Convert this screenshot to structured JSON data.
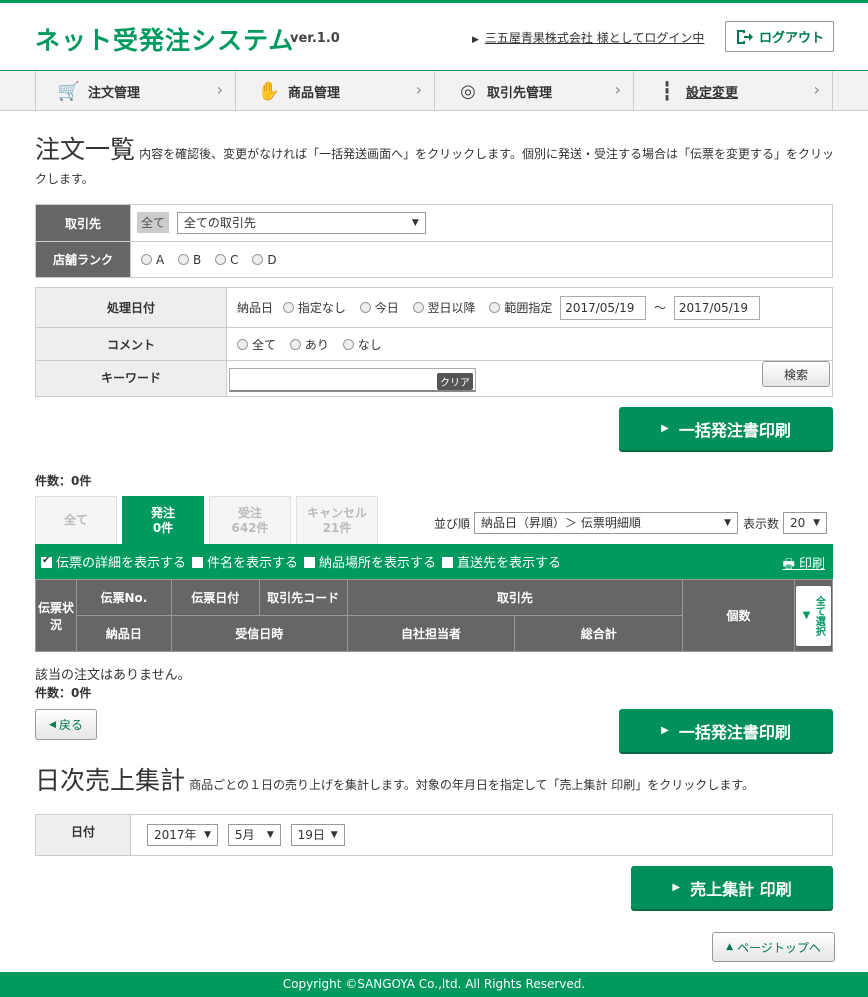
{
  "header": {
    "logo": "ネット受発注システム",
    "version": "ver.1.0",
    "company": "三五屋青果株式会社 様としてログイン中",
    "logout": "ログアウト"
  },
  "nav": [
    {
      "label": "注文管理"
    },
    {
      "label": "商品管理"
    },
    {
      "label": "取引先管理"
    },
    {
      "label": "設定変更"
    }
  ],
  "orders": {
    "title": "注文一覧",
    "desc": "内容を確認後、変更がなければ「一括発送画面へ」をクリックします。個別に発送・受注する場合は「伝票を変更する」をクリックします。",
    "filter": {
      "partner_label": "取引先",
      "partner_all": "全て",
      "partner_select": "全ての取引先",
      "rank_label": "店舗ランク",
      "ranks": [
        "A",
        "B",
        "C",
        "D"
      ],
      "date_label": "処理日付",
      "date_prefix": "納品日",
      "date_options": [
        "指定なし",
        "今日",
        "翌日以降",
        "範囲指定"
      ],
      "date_from": "2017/05/19",
      "date_sep": "～",
      "date_to": "2017/05/19",
      "comment_label": "コメント",
      "comment_options": [
        "全て",
        "あり",
        "なし"
      ],
      "keyword_label": "キーワード",
      "keyword_value": "",
      "clear": "クリア",
      "search": "検索"
    },
    "bulk_print": "一括発注書印刷",
    "count_text": "件数：0件",
    "tabs": [
      {
        "name": "全て",
        "count": ""
      },
      {
        "name": "発注",
        "count": "0件"
      },
      {
        "name": "受注",
        "count": "642件"
      },
      {
        "name": "キャンセル",
        "count": "21件"
      }
    ],
    "sort_label": "並び順",
    "sort_value": "納品日（昇順）＞ 伝票明細順",
    "per_page_label": "表示数",
    "per_page_value": "20",
    "options": [
      {
        "label": "伝票の詳細を表示する",
        "checked": true
      },
      {
        "label": "件名を表示する",
        "checked": false
      },
      {
        "label": "納品場所を表示する",
        "checked": false
      },
      {
        "label": "直送先を表示する",
        "checked": false
      }
    ],
    "print_link": "印刷",
    "cols": {
      "status": "伝票状況",
      "slip_no": "伝票No.",
      "slip_date": "伝票日付",
      "partner_code": "取引先コード",
      "partner": "取引先",
      "qty": "個数",
      "select_all": "全て選択",
      "delivery_date": "納品日",
      "received": "受信日時",
      "staff": "自社担当者",
      "total": "総合計"
    },
    "empty": "該当の注文はありません。",
    "back": "戻る"
  },
  "daily": {
    "title": "日次売上集計",
    "desc": "商品ごとの１日の売り上げを集計します。対象の年月日を指定して「売上集計 印刷」をクリックします。",
    "date_label": "日付",
    "year": "2017年",
    "month": "5月",
    "day": "19日",
    "print": "売上集計 印刷"
  },
  "page_top": "ページトップへ",
  "footer": "Copyright ©SANGOYA Co.,ltd. All Rights Reserved."
}
